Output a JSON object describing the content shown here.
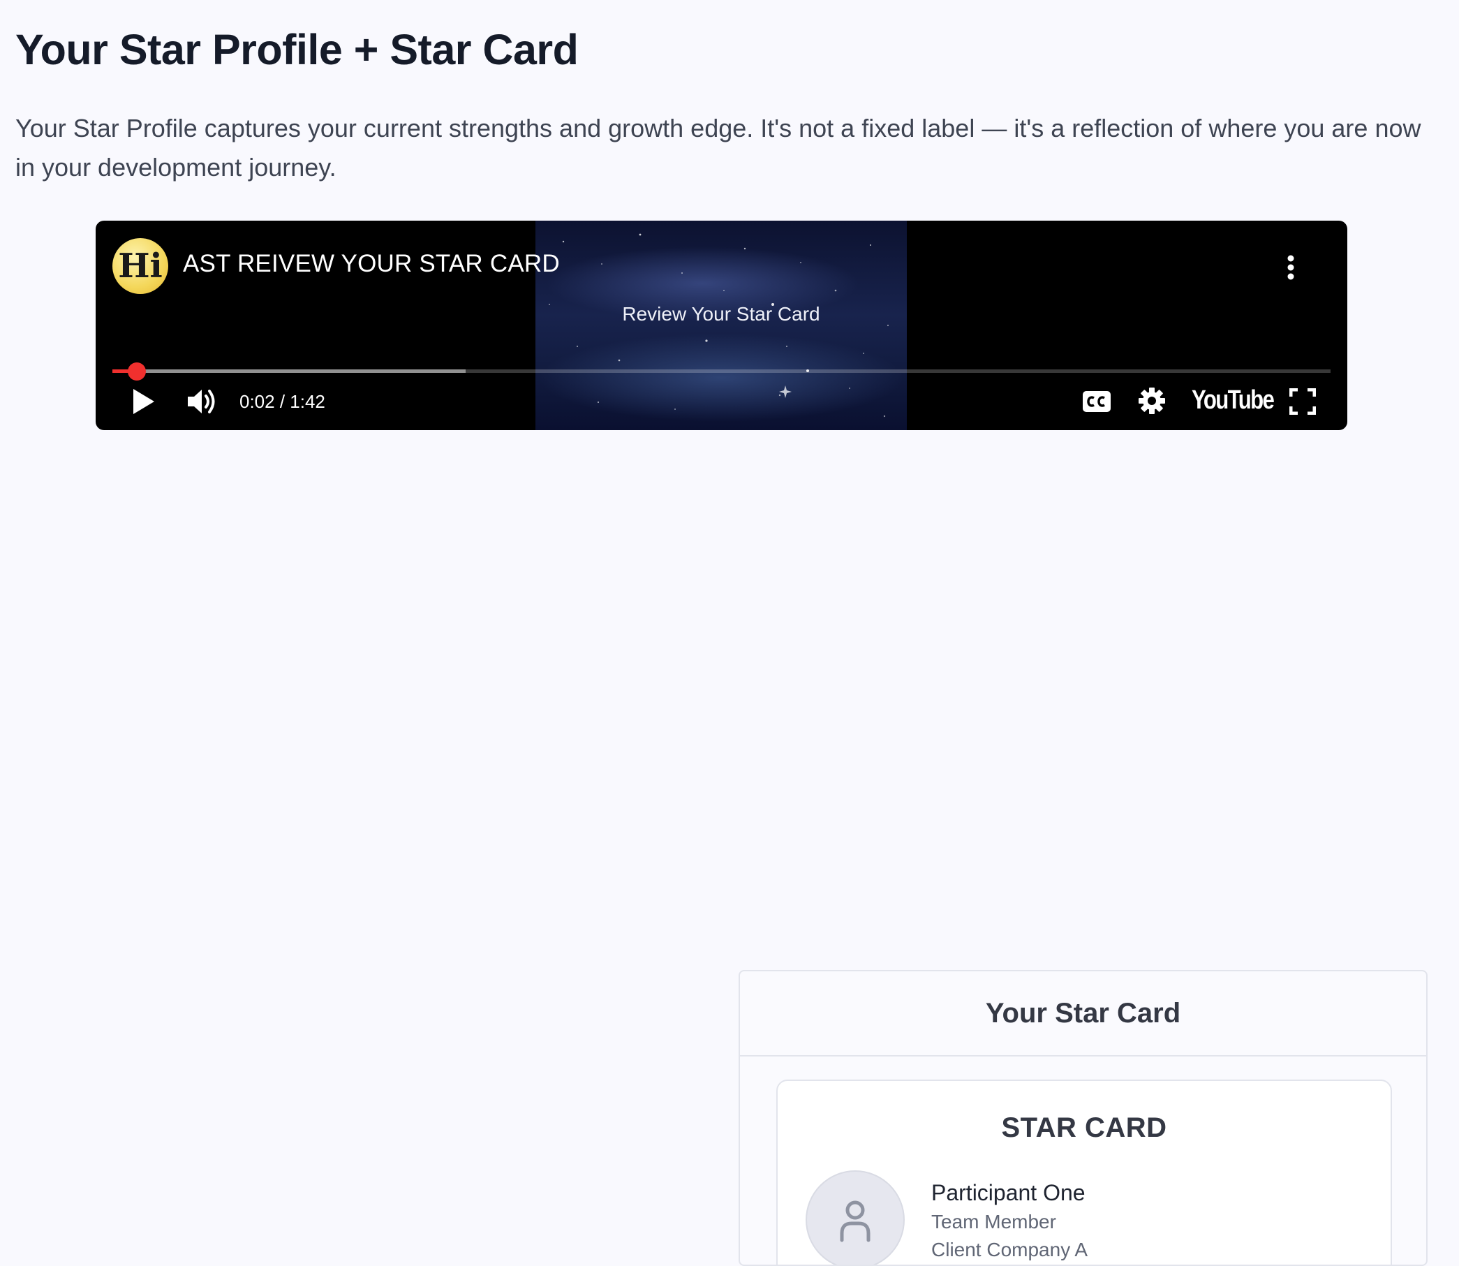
{
  "page": {
    "title": "Your Star Profile + Star Card",
    "intro": "Your Star Profile captures your current strengths and growth edge. It's not a fixed label — it's a reflection of where you are now in your development journey."
  },
  "video": {
    "channel_logo_text": "Hi",
    "title": "AST REIVEW YOUR STAR CARD",
    "frame_caption": "Review Your Star Card",
    "time_display": "0:02 / 1:42",
    "played_fraction": 0.02,
    "buffered_fraction": 0.29,
    "brand": "YouTube",
    "icons": {
      "menu": "more-vert-icon",
      "play": "play-icon",
      "volume": "volume-icon",
      "captions": "closed-captions-icon",
      "settings": "gear-icon",
      "fullscreen": "fullscreen-icon"
    },
    "colors": {
      "progress": "#f0302e"
    }
  },
  "star_card_panel": {
    "heading": "Your Star Card",
    "card": {
      "title": "STAR CARD",
      "participant": {
        "name": "Participant One",
        "role": "Team Member",
        "company": "Client Company A"
      },
      "avatar_icon": "user-icon"
    }
  }
}
